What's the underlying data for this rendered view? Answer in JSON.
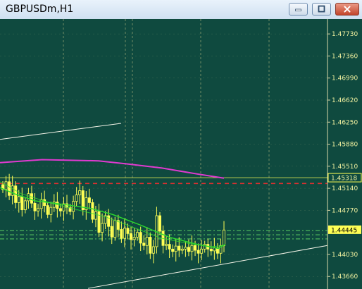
{
  "window": {
    "title": "GBPUSDm,H1",
    "buttons": [
      {
        "name": "minimize",
        "icon": "minimize-icon"
      },
      {
        "name": "maximize",
        "icon": "maximize-icon"
      },
      {
        "name": "close",
        "icon": "close-icon"
      }
    ]
  },
  "colors": {
    "background": "#0f4a3f",
    "grid": "#c8c88a",
    "candles": "#ffff55",
    "ma_fast": "#2cdc2c",
    "ma_slow": "#e03ad0",
    "red_level": "#e03030",
    "green_levels": "#66e066",
    "trendline": "#f4f4e8",
    "current_price_box": "#ffff55"
  },
  "chart_data": {
    "type": "candlestick",
    "symbol": "GBPUSDm",
    "timeframe": "H1",
    "y_ticks": [
      "1.47730",
      "1.47360",
      "1.46990",
      "1.46620",
      "1.46250",
      "1.45880",
      "1.45510",
      "1.45140",
      "1.44770",
      "1.44030",
      "1.43660"
    ],
    "ylim": [
      1.4345,
      1.4798
    ],
    "current_price": 1.44445,
    "current_price_label": "1.44445",
    "bid_line_price": 1.45318,
    "bid_line_label": "1.45318",
    "red_level": 1.4522,
    "green_levels": [
      1.4443,
      1.4436,
      1.4429
    ],
    "trendlines": [
      {
        "from": [
          0,
          1.4596
        ],
        "to": [
          172,
          1.4623
        ]
      },
      {
        "from": [
          125,
          1.4346
        ],
        "to": [
          465,
          1.4418
        ]
      }
    ],
    "ma_slow": [
      [
        0,
        1.4557
      ],
      [
        60,
        1.4562
      ],
      [
        140,
        1.456
      ],
      [
        180,
        1.4555
      ],
      [
        230,
        1.4548
      ],
      [
        280,
        1.4538
      ],
      [
        318,
        1.4531
      ]
    ],
    "ma_fast": [
      [
        0,
        1.4515
      ],
      [
        20,
        1.4505
      ],
      [
        50,
        1.4493
      ],
      [
        90,
        1.4487
      ],
      [
        130,
        1.448
      ],
      [
        160,
        1.447
      ],
      [
        200,
        1.4452
      ],
      [
        240,
        1.4432
      ],
      [
        280,
        1.442
      ],
      [
        310,
        1.4413
      ],
      [
        320,
        1.442
      ]
    ],
    "ma_fast2": [
      [
        0,
        1.4525
      ],
      [
        30,
        1.4505
      ],
      [
        70,
        1.449
      ],
      [
        110,
        1.4478
      ],
      [
        150,
        1.4466
      ],
      [
        190,
        1.4448
      ],
      [
        230,
        1.443
      ],
      [
        270,
        1.4421
      ],
      [
        300,
        1.4416
      ],
      [
        318,
        1.4418
      ]
    ],
    "candles_close": [
      1.4512,
      1.4525,
      1.4502,
      1.4518,
      1.449,
      1.45,
      1.4478,
      1.4493,
      1.4505,
      1.4489,
      1.4476,
      1.448,
      1.4495,
      1.4485,
      1.447,
      1.4482,
      1.4491,
      1.448,
      1.4476,
      1.4488,
      1.4482,
      1.4475,
      1.4492,
      1.4503,
      1.451,
      1.4478,
      1.4498,
      1.449,
      1.4462,
      1.4475,
      1.444,
      1.4455,
      1.4468,
      1.445,
      1.4432,
      1.446,
      1.4445,
      1.443,
      1.4447,
      1.4438,
      1.4428,
      1.4432,
      1.444,
      1.4422,
      1.4418,
      1.4432,
      1.4405,
      1.4416,
      1.4468,
      1.4442,
      1.4418,
      1.442,
      1.4412,
      1.4408,
      1.4417,
      1.441,
      1.4412,
      1.4415,
      1.4408,
      1.4418,
      1.441,
      1.4405,
      1.4412,
      1.442,
      1.4412,
      1.4409,
      1.4414,
      1.4405,
      1.4418,
      1.4444
    ]
  }
}
